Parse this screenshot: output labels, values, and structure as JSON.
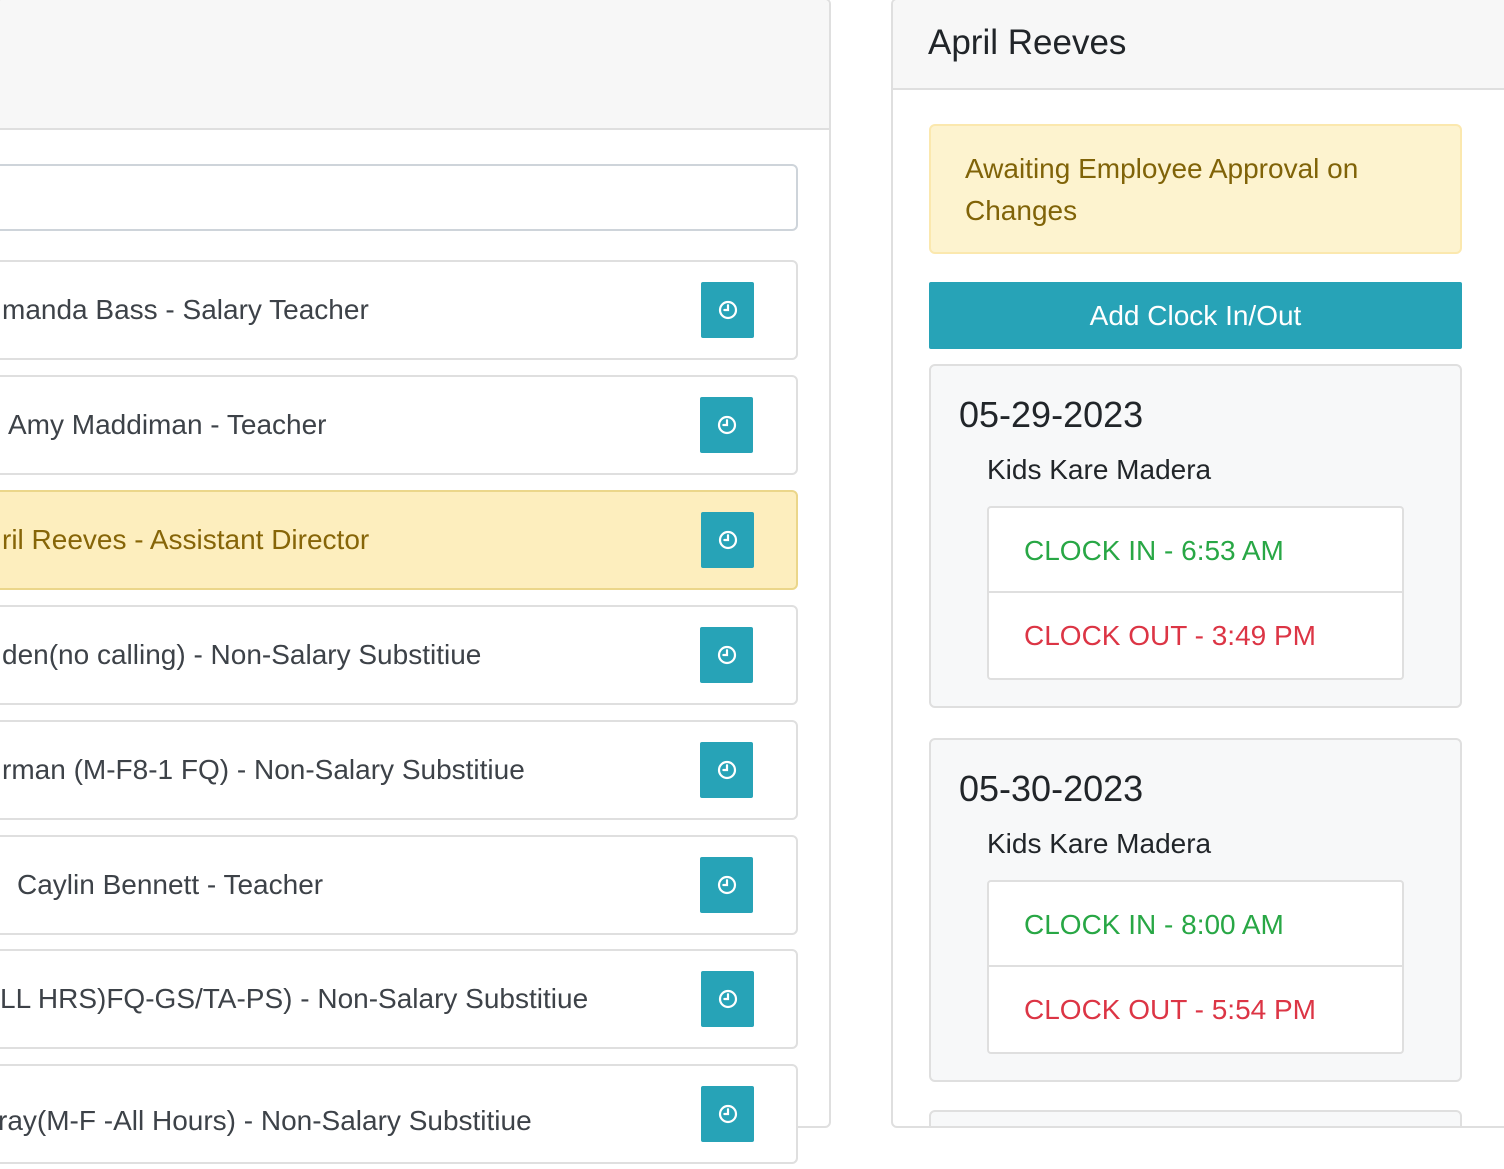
{
  "employee_list": {
    "search": {
      "value": "",
      "placeholder": ""
    },
    "items": [
      {
        "label": "manda Bass - Salary Teacher",
        "active": false
      },
      {
        "label": "Amy Maddiman - Teacher",
        "active": false
      },
      {
        "label": "ril Reeves - Assistant Director",
        "active": true
      },
      {
        "label": "den(no calling) - Non-Salary Substitiue",
        "active": false
      },
      {
        "label": "rman (M-F8-1 FQ) - Non-Salary Substitiue",
        "active": false
      },
      {
        "label": "Caylin Bennett - Teacher",
        "active": false
      },
      {
        "label": "LL HRS)FQ-GS/TA-PS) - Non-Salary Substitiue",
        "active": false
      },
      {
        "label": "ray(M-F -All Hours) - Non-Salary Substitiue",
        "active": false
      }
    ],
    "action_icon": "clock-icon"
  },
  "detail": {
    "employee_name": "April Reeves",
    "alert": "Awaiting Employee Approval on Changes",
    "add_button_label": "Add Clock In/Out",
    "days": [
      {
        "date": "05-29-2023",
        "location": "Kids Kare Madera",
        "clock_in": "CLOCK IN - 6:53 AM",
        "clock_out": "CLOCK OUT - 3:49 PM"
      },
      {
        "date": "05-30-2023",
        "location": "Kids Kare Madera",
        "clock_in": "CLOCK IN - 8:00 AM",
        "clock_out": "CLOCK OUT - 5:54 PM"
      }
    ]
  },
  "colors": {
    "accent": "#27a3b7",
    "active_row_bg": "#fdeebe",
    "alert_bg": "#fdf3cf",
    "clock_in_text": "#28a745",
    "clock_out_text": "#dc3545"
  }
}
